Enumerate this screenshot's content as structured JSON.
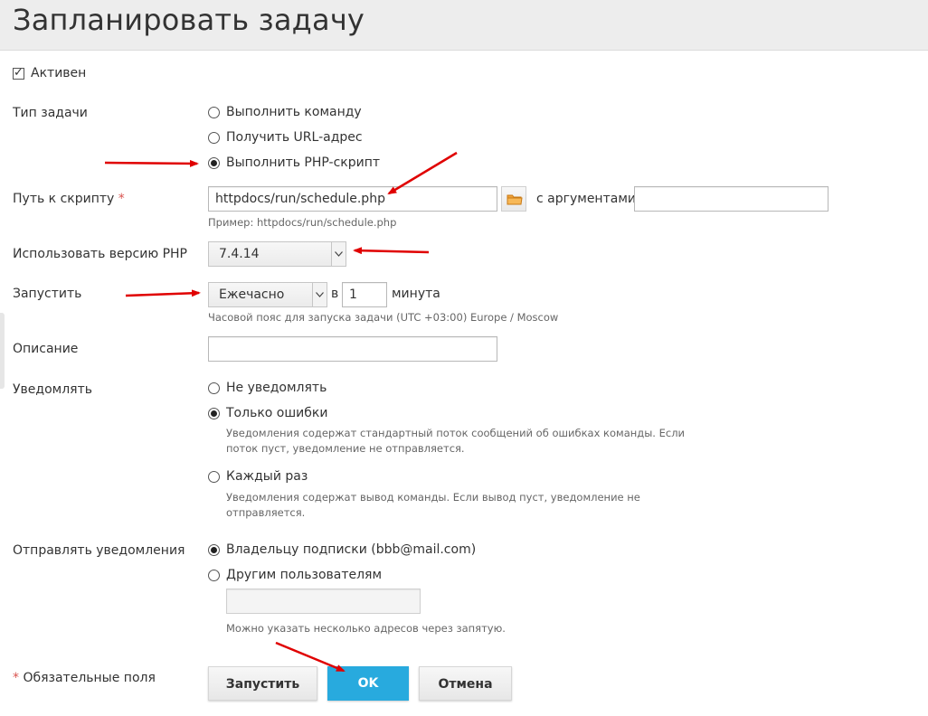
{
  "page": {
    "title": "Запланировать задачу"
  },
  "active": {
    "label": "Активен",
    "checked": true
  },
  "task_type": {
    "label": "Тип задачи",
    "options": [
      {
        "label": "Выполнить команду",
        "selected": false
      },
      {
        "label": "Получить URL-адрес",
        "selected": false
      },
      {
        "label": "Выполнить PHP-скрипт",
        "selected": true
      }
    ]
  },
  "script_path": {
    "label": "Путь к скрипту",
    "required_mark": "*",
    "value": "httpdocs/run/schedule.php",
    "hint": "Пример: httpdocs/run/schedule.php",
    "args_label": "с аргументами",
    "args_value": ""
  },
  "php_version": {
    "label": "Использовать версию PHP",
    "value": "7.4.14"
  },
  "run": {
    "label": "Запустить",
    "frequency": "Ежечасно",
    "at_label": "в",
    "minute_value": "1",
    "minute_label": "минута",
    "hint": "Часовой пояс для запуска задачи (UTC +03:00) Europe / Moscow"
  },
  "description": {
    "label": "Описание",
    "value": ""
  },
  "notify": {
    "label": "Уведомлять",
    "options": [
      {
        "label": "Не уведомлять",
        "selected": false,
        "hint_line1": "",
        "hint_line2": ""
      },
      {
        "label": "Только ошибки",
        "selected": true,
        "hint_line1": "Уведомления содержат стандартный поток сообщений об ошибках команды. Если",
        "hint_line2": "поток пуст, уведомление не отправляется."
      },
      {
        "label": "Каждый раз",
        "selected": false,
        "hint_line1": "Уведомления содержат вывод команды. Если вывод пуст, уведомление не",
        "hint_line2": "отправляется."
      }
    ]
  },
  "send_to": {
    "label": "Отправлять уведомления",
    "options": [
      {
        "label": "Владельцу подписки (bbb@mail.com)",
        "selected": true
      },
      {
        "label": "Другим пользователям",
        "selected": false
      }
    ],
    "other_users_value": "",
    "hint": "Можно указать несколько адресов через запятую."
  },
  "footer": {
    "required_mark": "*",
    "required_note": "Обязательные поля",
    "run_button": "Запустить",
    "ok_button": "OK",
    "cancel_button": "Отмена"
  },
  "colors": {
    "primary_button": "#28aade",
    "annotation_arrow": "#e00000",
    "required_mark": "#d9534f",
    "header_bg": "#ededed"
  },
  "icons": {
    "checkbox_tick": "check-icon",
    "folder": "folder-icon",
    "dropdown": "chevron-down-icon"
  }
}
